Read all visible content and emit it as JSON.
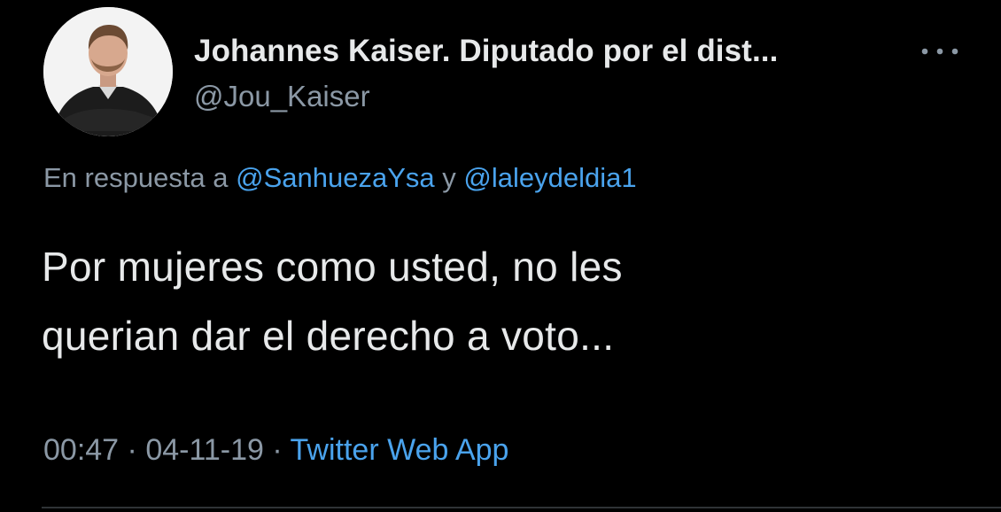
{
  "tweet": {
    "display_name": "Johannes Kaiser. Diputado por el dist...",
    "handle": "@Jou_Kaiser",
    "avatar_icon": "user-avatar-photo",
    "more_icon": "more-options-icon",
    "reply": {
      "prefix": "En respuesta a",
      "mention_1": "@SanhuezaYsa",
      "connector": "y",
      "mention_2": "@laleydeldia1"
    },
    "text_lines": [
      "Por mujeres como usted, no les",
      "querian dar el derecho a voto..."
    ],
    "meta": {
      "time": "00:47",
      "separator": "·",
      "date": "04-11-19",
      "source": "Twitter Web App"
    }
  },
  "colors": {
    "background": "#000000",
    "primary_text": "#e7e9ea",
    "secondary_text": "#8b98a5",
    "link": "#4aa3ed",
    "divider": "#2f3336"
  }
}
